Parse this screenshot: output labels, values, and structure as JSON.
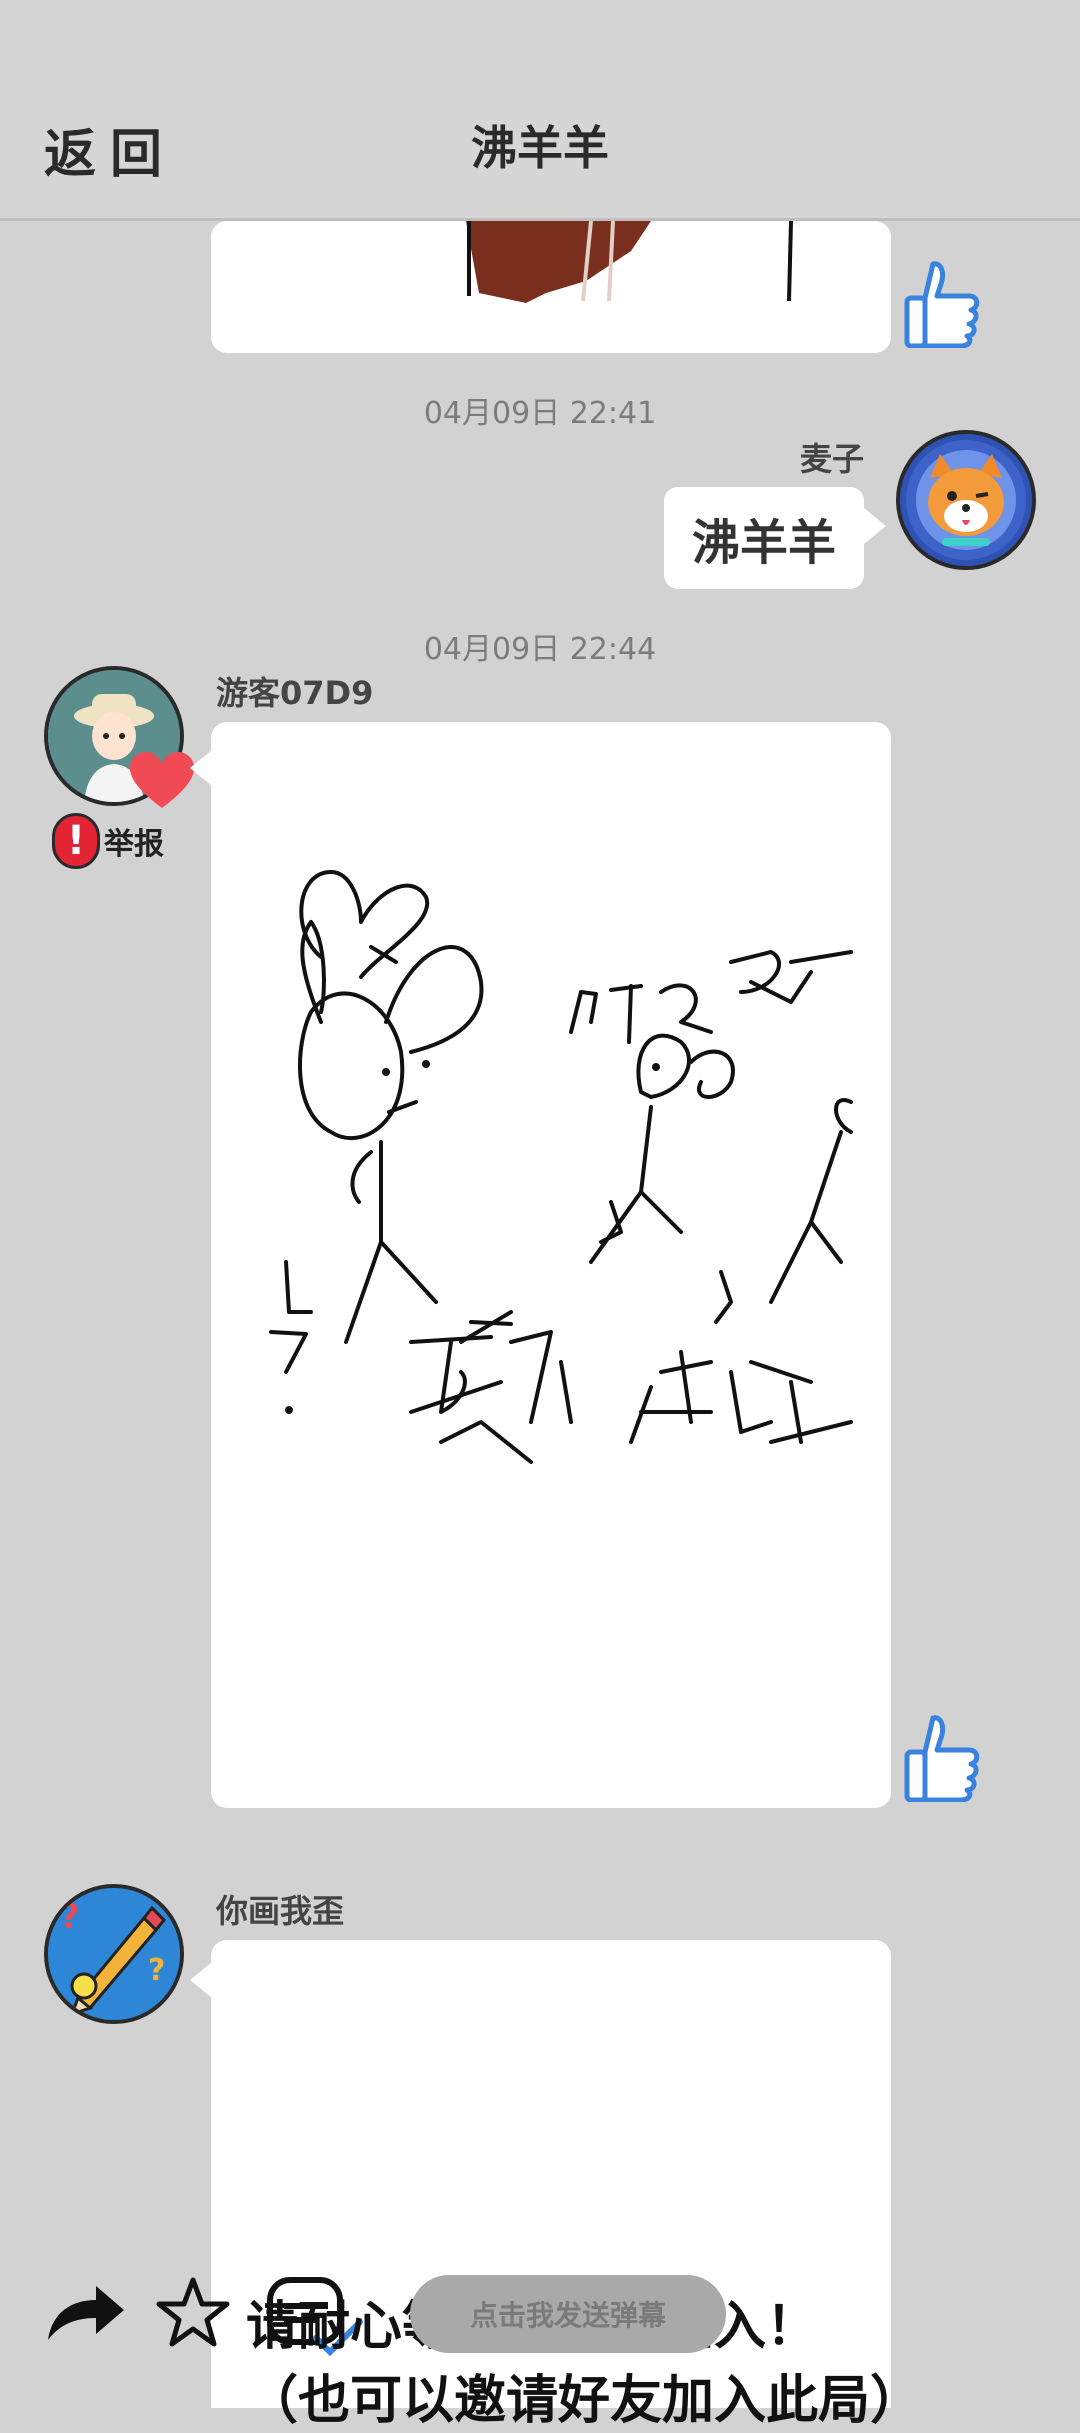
{
  "header": {
    "back_label": "返回",
    "title": "沸羊羊"
  },
  "messages": {
    "ts1": "04月09日  22:41",
    "sender1": "麦子",
    "sent_text": "沸羊羊",
    "ts2": "04月09日  22:44",
    "sender2": "游客07D9",
    "report_label": "举报",
    "sender3": "你画我歪"
  },
  "bottom": {
    "line1": "请耐心等待其他人加入！",
    "line2": "（也可以邀请好友加入此局）",
    "danmaku_label": "点击我发送弹幕"
  },
  "icons": {
    "like": "thumbs-up-icon",
    "share": "share-arrow-icon",
    "star": "star-icon",
    "check": "checkmark-icon",
    "alert": "exclamation-icon"
  },
  "colors": {
    "background": "#d2d2d2",
    "header_bg": "#d6d6d6",
    "like_blue": "#3a82e0",
    "report_red": "#e32434",
    "heart": "#f04a55"
  }
}
